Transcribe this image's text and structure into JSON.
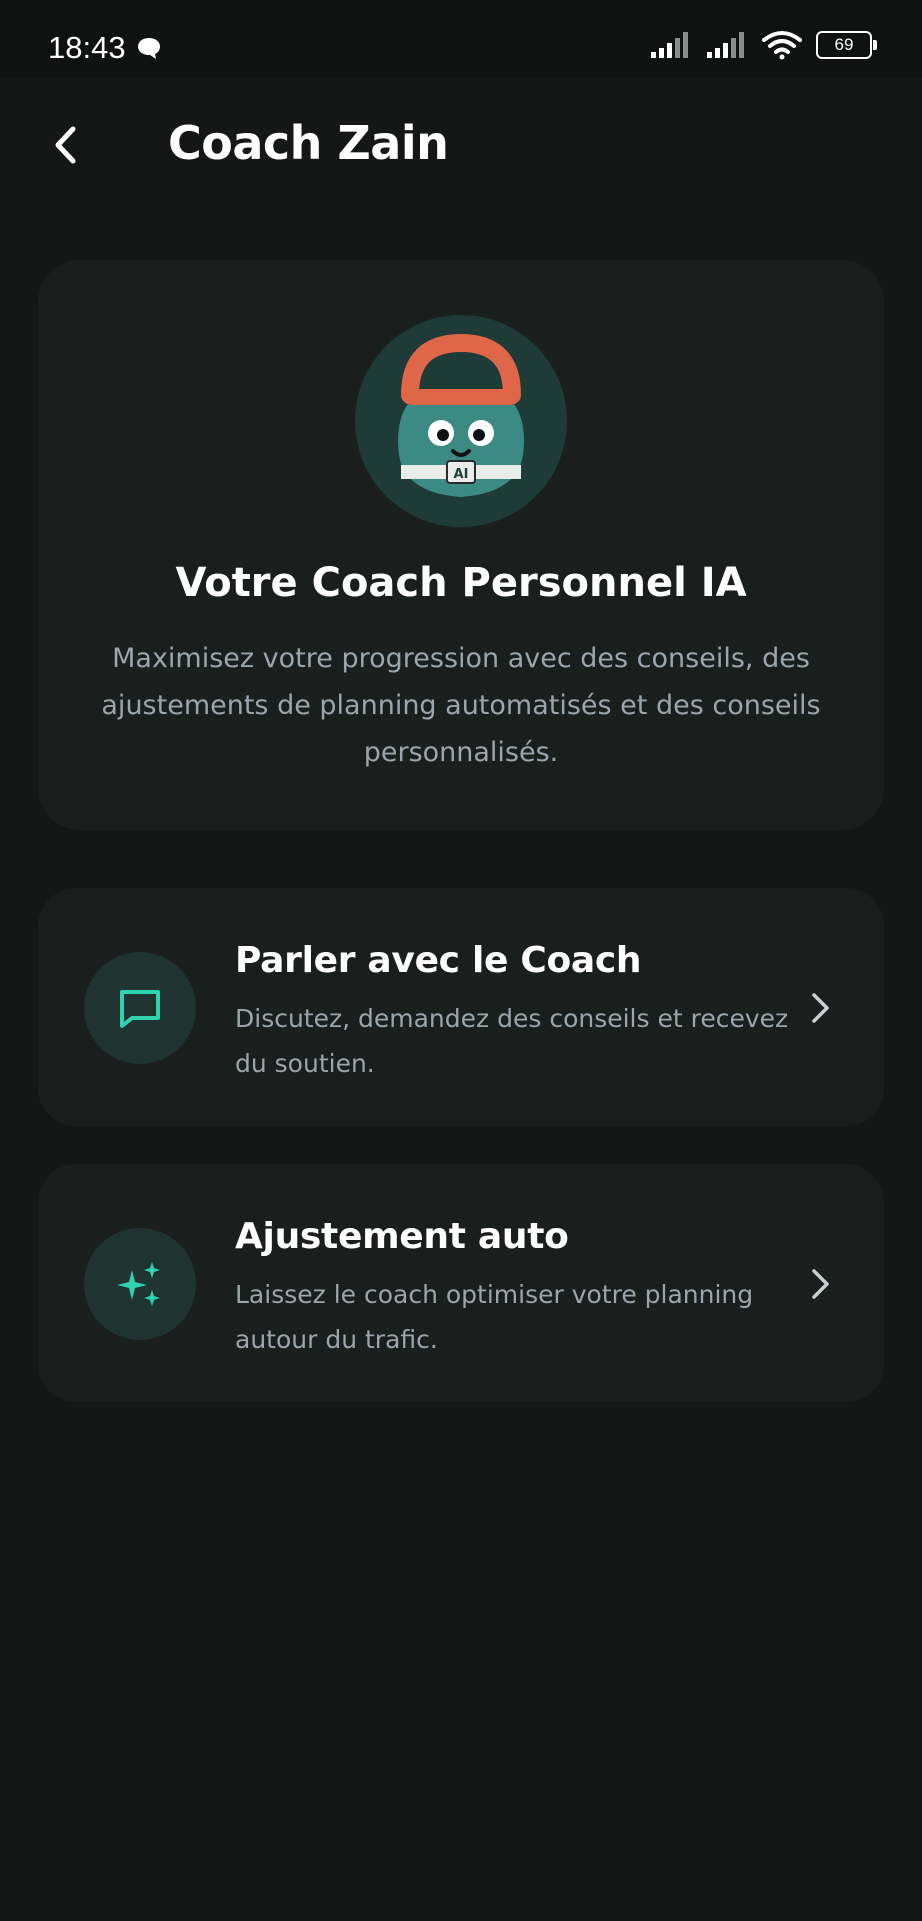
{
  "status_bar": {
    "time": "18:43",
    "battery": "69"
  },
  "header": {
    "title": "Coach Zain"
  },
  "hero": {
    "title": "Votre Coach Personnel IA",
    "description": "Maximisez votre progression avec des conseils, des ajustements de planning automatisés et des conseils personnalisés.",
    "mascot_badge": "AI"
  },
  "actions": [
    {
      "title": "Parler avec le Coach",
      "description": "Discutez, demandez des conseils et recevez du soutien.",
      "icon": "chat-icon"
    },
    {
      "title": "Ajustement auto",
      "description": "Laissez le coach optimiser votre planning autour du trafic.",
      "icon": "sparkles-icon"
    }
  ],
  "colors": {
    "background": "#141716",
    "card": "#1a1e1d",
    "accent": "#2fd3b0",
    "text_secondary": "#9aa5ac",
    "mascot_handle": "#e0664a",
    "mascot_body": "#3c8a84"
  }
}
